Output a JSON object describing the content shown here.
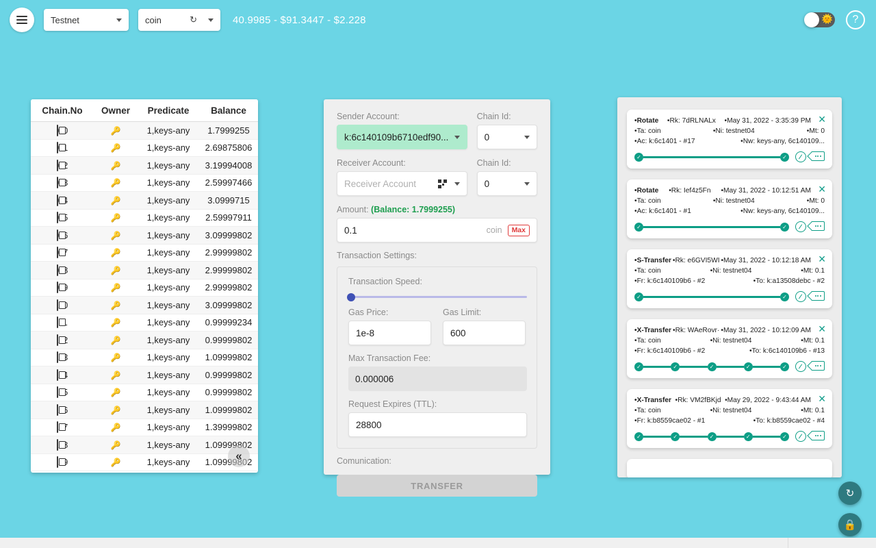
{
  "topbar": {
    "menu_icon": "hamburger-icon",
    "network": {
      "value": "Testnet"
    },
    "token": {
      "value": "coin",
      "refresh_icon": "refresh-icon"
    },
    "prices": "40.9985 - $91.3447 - $2.228",
    "theme_toggle": {
      "icon": "sun-icon",
      "state": "off"
    },
    "help_label": "?"
  },
  "accounts": {
    "columns": [
      "Chain.No",
      "Owner",
      "Predicate",
      "Balance"
    ],
    "collapse_label": "«",
    "rows": [
      {
        "chain": "00",
        "owner": "key-icon",
        "predicate": "1,keys-any",
        "balance": "1.7999255"
      },
      {
        "chain": "01",
        "owner": "key-icon",
        "predicate": "1,keys-any",
        "balance": "2.69875806"
      },
      {
        "chain": "02",
        "owner": "key-icon",
        "predicate": "1,keys-any",
        "balance": "3.19994008"
      },
      {
        "chain": "03",
        "owner": "key-icon",
        "predicate": "1,keys-any",
        "balance": "2.59997466"
      },
      {
        "chain": "04",
        "owner": "key-icon",
        "predicate": "1,keys-any",
        "balance": "3.0999715"
      },
      {
        "chain": "05",
        "owner": "key-icon",
        "predicate": "1,keys-any",
        "balance": "2.59997911"
      },
      {
        "chain": "06",
        "owner": "key-icon",
        "predicate": "1,keys-any",
        "balance": "3.09999802"
      },
      {
        "chain": "07",
        "owner": "key-icon",
        "predicate": "1,keys-any",
        "balance": "2.99999802"
      },
      {
        "chain": "08",
        "owner": "key-icon",
        "predicate": "1,keys-any",
        "balance": "2.99999802"
      },
      {
        "chain": "09",
        "owner": "key-icon",
        "predicate": "1,keys-any",
        "balance": "2.99999802"
      },
      {
        "chain": "10",
        "owner": "key-icon",
        "predicate": "1,keys-any",
        "balance": "3.09999802"
      },
      {
        "chain": "11",
        "owner": "key-icon",
        "predicate": "1,keys-any",
        "balance": "0.99999234"
      },
      {
        "chain": "12",
        "owner": "key-icon",
        "predicate": "1,keys-any",
        "balance": "0.99999802"
      },
      {
        "chain": "13",
        "owner": "key-icon",
        "predicate": "1,keys-any",
        "balance": "1.09999802"
      },
      {
        "chain": "14",
        "owner": "key-icon",
        "predicate": "1,keys-any",
        "balance": "0.99999802"
      },
      {
        "chain": "15",
        "owner": "key-icon",
        "predicate": "1,keys-any",
        "balance": "0.99999802"
      },
      {
        "chain": "16",
        "owner": "key-icon",
        "predicate": "1,keys-any",
        "balance": "1.09999802"
      },
      {
        "chain": "17",
        "owner": "key-icon",
        "predicate": "1,keys-any",
        "balance": "1.39999802"
      },
      {
        "chain": "18",
        "owner": "key-icon",
        "predicate": "1,keys-any",
        "balance": "1.09999802"
      },
      {
        "chain": "19",
        "owner": "key-icon",
        "predicate": "1,keys-any",
        "balance": "1.09999802"
      }
    ]
  },
  "form": {
    "sender_label": "Sender Account:",
    "sender_value": "k:6c140109b6710edf90...",
    "sender_chain_label": "Chain Id:",
    "sender_chain_value": "0",
    "receiver_label": "Receiver Account:",
    "receiver_placeholder": "Receiver Account",
    "receiver_chain_label": "Chain Id:",
    "receiver_chain_value": "0",
    "amount_label": "Amount:",
    "balance_label": "(Balance: 1.7999255)",
    "amount_value": "0.1",
    "amount_unit": "coin",
    "max_label": "Max",
    "settings_label": "Transaction Settings:",
    "speed_label": "Transaction Speed:",
    "speed_value": 0,
    "gas_price_label": "Gas Price:",
    "gas_price_value": "1e-8",
    "gas_limit_label": "Gas Limit:",
    "gas_limit_value": "600",
    "max_fee_label": "Max Transaction Fee:",
    "max_fee_value": "0.000006",
    "ttl_label": "Request Expires (TTL):",
    "ttl_value": "28800",
    "communication_label": "Comunication:",
    "transfer_label": "TRANSFER"
  },
  "transactions": [
    {
      "type": "Rotate",
      "rk": "Rk: 7dRLNALx",
      "date": "May 31, 2022 - 3:35:39 PM",
      "ta": "Ta: coin",
      "ni": "Ni: testnet04",
      "mt": "Mt: 0",
      "from": "Ac: k:6c1401 - #17",
      "to": "Nw: keys-any, 6c140109...",
      "steps": 2
    },
    {
      "type": "Rotate",
      "rk": "Rk: Ief4z5Fn",
      "date": "May 31, 2022 - 10:12:51 AM",
      "ta": "Ta: coin",
      "ni": "Ni: testnet04",
      "mt": "Mt: 0",
      "from": "Ac: k:6c1401 - #1",
      "to": "Nw: keys-any, 6c140109...",
      "steps": 2
    },
    {
      "type": "S-Transfer",
      "rk": "Rk: e6GVI5WI",
      "date": "May 31, 2022 - 10:12:18 AM",
      "ta": "Ta: coin",
      "ni": "Ni: testnet04",
      "mt": "Mt: 0.1",
      "from": "Fr: k:6c140109b6 - #2",
      "to": "To: k:a13508debc - #2",
      "steps": 2
    },
    {
      "type": "X-Transfer",
      "rk": "Rk: WAeRovr·",
      "date": "May 31, 2022 - 10:12:09 AM",
      "ta": "Ta: coin",
      "ni": "Ni: testnet04",
      "mt": "Mt: 0.1",
      "from": "Fr: k:6c140109b6 - #2",
      "to": "To: k:6c140109b6 - #13",
      "steps": 5
    },
    {
      "type": "X-Transfer",
      "rk": "Rk: VM2fBKjd",
      "date": "May 29, 2022 - 9:43:44 AM",
      "ta": "Ta: coin",
      "ni": "Ni: testnet04",
      "mt": "Mt: 0.1",
      "from": "Fr: k:b8559cae02 - #1",
      "to": "To: k:b8559cae02 - #4",
      "steps": 5
    }
  ],
  "fabs": {
    "sync_icon": "sync-icon",
    "lock_icon": "lock-icon"
  },
  "colors": {
    "background": "#6BD5E5",
    "accent_green": "#0d9e86",
    "sender_highlight": "#aeebcd",
    "max_red": "#e03b3b"
  }
}
